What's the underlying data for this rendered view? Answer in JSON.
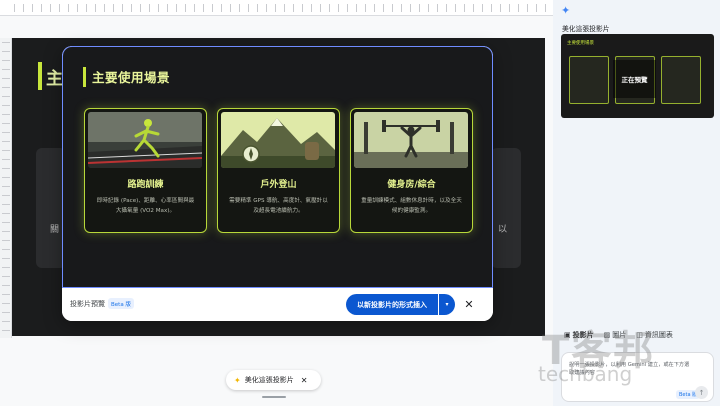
{
  "slide_background": {
    "title_partial": "主",
    "side_left_text": "關",
    "side_right_text": "以"
  },
  "preview": {
    "heading": "主要使用場景",
    "cards": [
      {
        "title": "路跑訓練",
        "description": "即時記錄 (Pace)、距離、心率區間與最大攝氧量 (VO2 Max)。"
      },
      {
        "title": "戶外登山",
        "description": "需要精準 GPS 導航、高度計、氣壓計以及超長電池續航力。"
      },
      {
        "title": "健身房/綜合",
        "description": "重量訓練模式、組數休息計時，以及全天候的健康監測。"
      }
    ]
  },
  "footer": {
    "label": "投影片預覽",
    "beta": "Beta 版",
    "insert_label": "以新投影片的形式插入",
    "caret": "▾",
    "close": "✕"
  },
  "bottom_chip": {
    "label": "美化這張投影片",
    "close": "✕"
  },
  "panel": {
    "title": "美化這張投影片",
    "thumb_title": "主要使用場景",
    "thumb_overlay": "正在預覽",
    "tabs": [
      {
        "icon": "▣",
        "label": "投影片"
      },
      {
        "icon": "▨",
        "label": "圖片"
      },
      {
        "icon": "◫",
        "label": "資訊圖表"
      }
    ],
    "prompt_text": "說明一張投影片，以利用 Gemini 建立，或在下方選取建議內容",
    "prompt_beta": "Beta 版",
    "send": "↑"
  },
  "watermark": {
    "main": "T客邦",
    "sub": "techbang"
  },
  "colors": {
    "accent_lime": "#c8e63c",
    "primary_blue": "#0b57d0",
    "preview_border": "#6f8cff"
  }
}
